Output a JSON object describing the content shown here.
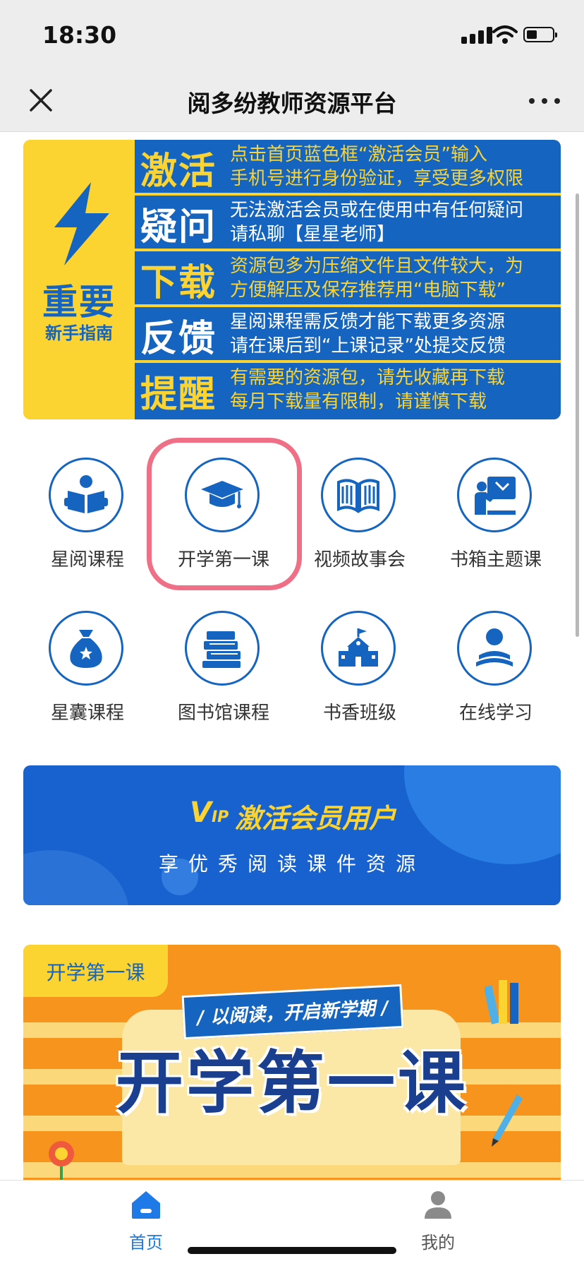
{
  "status_bar": {
    "time": "18:30"
  },
  "nav": {
    "title": "阅多纷教师资源平台"
  },
  "guide_banner": {
    "title": "重要",
    "subtitle": "新手指南",
    "rows": [
      {
        "key": "激活",
        "line1": "点击首页蓝色框“激活会员”输入",
        "line2": "手机号进行身份验证，享受更多权限"
      },
      {
        "key": "疑问",
        "line1": "无法激活会员或在使用中有任何疑问",
        "line2": "请私聊【星星老师】"
      },
      {
        "key": "下载",
        "line1": "资源包多为压缩文件且文件较大，为",
        "line2": "方便解压及保存推荐用“电脑下载”"
      },
      {
        "key": "反馈",
        "line1": "星阅课程需反馈才能下载更多资源",
        "line2": "请在课后到“上课记录”处提交反馈"
      },
      {
        "key": "提醒",
        "line1": "有需要的资源包，请先收藏再下载",
        "line2": "每月下载量有限制，请谨慎下载"
      }
    ]
  },
  "grid": [
    {
      "label": "星阅课程",
      "icon": "reading-person-icon"
    },
    {
      "label": "开学第一课",
      "icon": "graduation-cap-icon"
    },
    {
      "label": "视频故事会",
      "icon": "open-book-icon"
    },
    {
      "label": "书箱主题课",
      "icon": "teacher-board-icon"
    },
    {
      "label": "星囊课程",
      "icon": "money-bag-icon"
    },
    {
      "label": "图书馆课程",
      "icon": "book-stack-icon"
    },
    {
      "label": "书香班级",
      "icon": "school-building-icon"
    },
    {
      "label": "在线学习",
      "icon": "person-reading-icon"
    }
  ],
  "vip_banner": {
    "logo": "V",
    "logo_small": "IP",
    "title": "激活会员用户",
    "subtitle": "享优秀阅读课件资源"
  },
  "course_banner": {
    "tag": "开学第一课",
    "ribbon": "/ 以阅读，开启新学期 /",
    "title": "开学第一课"
  },
  "tab_bar": {
    "items": [
      {
        "label": "首页",
        "active": true,
        "icon": "home-icon"
      },
      {
        "label": "我的",
        "active": false,
        "icon": "user-icon"
      }
    ]
  },
  "colors": {
    "primary": "#1565c0",
    "accent_yellow": "#fbd431",
    "highlight": "#ee6f86",
    "tab_active": "#1e7ae6",
    "tab_inactive": "#555555"
  }
}
